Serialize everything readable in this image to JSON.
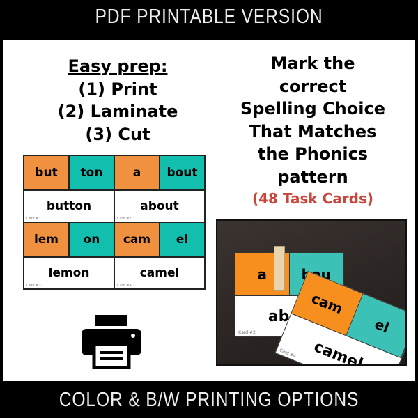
{
  "header": {
    "title": "PDF PRINTABLE VERSION"
  },
  "footer": {
    "title": "COLOR & B/W PRINTING OPTIONS"
  },
  "left": {
    "heading": "Easy prep:",
    "steps": [
      "(1) Print",
      "(2) Laminate",
      "(3) Cut"
    ]
  },
  "right": {
    "lines": [
      "Mark the",
      "correct",
      "Spelling Choice",
      "That Matches",
      "the Phonics",
      "pattern"
    ],
    "note": "(48 Task Cards)"
  },
  "cards": [
    {
      "parts": [
        "but",
        "ton"
      ],
      "word": "button",
      "label": "Card #1"
    },
    {
      "parts": [
        "a",
        "bout"
      ],
      "word": "about",
      "label": "Card #2"
    },
    {
      "parts": [
        "lem",
        "on"
      ],
      "word": "lemon",
      "label": "Card #3"
    },
    {
      "parts": [
        "cam",
        "el"
      ],
      "word": "camel",
      "label": "Card #4"
    }
  ],
  "photo": {
    "back": {
      "parts": [
        "a",
        "bou"
      ],
      "word": "abou",
      "label": "Card #2"
    },
    "front": {
      "parts": [
        "cam",
        "el"
      ],
      "word": "camel",
      "label": "Card #4"
    }
  },
  "icons": {
    "printer": "printer-icon"
  },
  "colors": {
    "orange": "#f0913f",
    "teal": "#12bfae",
    "red": "#c9463d"
  }
}
